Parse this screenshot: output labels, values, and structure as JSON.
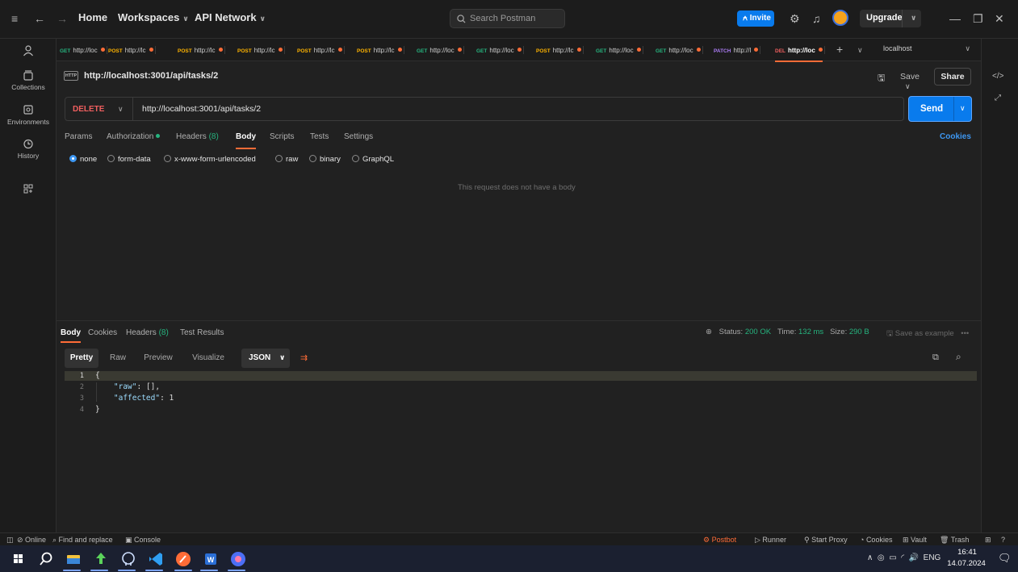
{
  "topbar": {
    "home": "Home",
    "workspaces": "Workspaces",
    "api_network": "API Network",
    "search_placeholder": "Search Postman",
    "invite": "Invite",
    "upgrade": "Upgrade"
  },
  "sidebar": {
    "items": [
      {
        "label": "Collections",
        "icon": "collections-icon"
      },
      {
        "label": "Environments",
        "icon": "environments-icon"
      },
      {
        "label": "History",
        "icon": "history-icon"
      }
    ]
  },
  "tabs": [
    {
      "method": "GET",
      "url": "http://loc",
      "color": "#26b47f"
    },
    {
      "method": "POST",
      "url": "http://lc",
      "color": "#ffb400"
    },
    {
      "method": "POST",
      "url": "http://lc",
      "color": "#ffb400"
    },
    {
      "method": "POST",
      "url": "http://lc",
      "color": "#ffb400"
    },
    {
      "method": "POST",
      "url": "http://lc",
      "color": "#ffb400"
    },
    {
      "method": "POST",
      "url": "http://lc",
      "color": "#ffb400"
    },
    {
      "method": "GET",
      "url": "http://loc",
      "color": "#26b47f"
    },
    {
      "method": "GET",
      "url": "http://loc",
      "color": "#26b47f"
    },
    {
      "method": "POST",
      "url": "http://lc",
      "color": "#ffb400"
    },
    {
      "method": "GET",
      "url": "http://loc",
      "color": "#26b47f"
    },
    {
      "method": "GET",
      "url": "http://loc",
      "color": "#26b47f"
    },
    {
      "method": "PATCH",
      "url": "http://l",
      "color": "#a97bf2"
    },
    {
      "method": "DEL",
      "url": "http://loc",
      "color": "#f05f5f"
    }
  ],
  "environment": "localhost",
  "request": {
    "title": "http://localhost:3001/api/tasks/2",
    "method": "DELETE",
    "url": "http://localhost:3001/api/tasks/2",
    "save": "Save",
    "share": "Share",
    "send": "Send",
    "tabs": {
      "params": "Params",
      "authorization": "Authorization",
      "headers": "Headers",
      "headers_count": "(8)",
      "body": "Body",
      "scripts": "Scripts",
      "tests": "Tests",
      "settings": "Settings"
    },
    "cookies": "Cookies",
    "body_types": [
      "none",
      "form-data",
      "x-www-form-urlencoded",
      "raw",
      "binary",
      "GraphQL"
    ],
    "selected_body_type": "none",
    "no_body_message": "This request does not have a body"
  },
  "response": {
    "tabs": {
      "body": "Body",
      "cookies": "Cookies",
      "headers": "Headers",
      "headers_count": "(8)",
      "test_results": "Test Results"
    },
    "status_label": "Status:",
    "status_value": "200 OK",
    "time_label": "Time:",
    "time_value": "132 ms",
    "size_label": "Size:",
    "size_value": "290 B",
    "save_as_example": "Save as example",
    "views": [
      "Pretty",
      "Raw",
      "Preview",
      "Visualize"
    ],
    "format": "JSON",
    "lines": [
      {
        "n": "1",
        "text": "{"
      },
      {
        "n": "2",
        "key": "\"raw\"",
        "value": " [],"
      },
      {
        "n": "3",
        "key": "\"affected\"",
        "value": " 1"
      },
      {
        "n": "4",
        "text": "}"
      }
    ]
  },
  "statusbar": {
    "online": "Online",
    "find_replace": "Find and replace",
    "console": "Console",
    "postbot": "Postbot",
    "runner": "Runner",
    "start_proxy": "Start Proxy",
    "cookies": "Cookies",
    "vault": "Vault",
    "trash": "Trash"
  },
  "taskbar": {
    "lang": "ENG",
    "time": "16:41",
    "date": "14.07.2024"
  }
}
